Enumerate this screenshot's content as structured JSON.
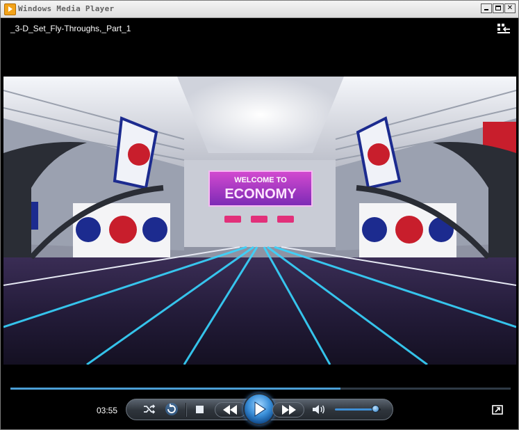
{
  "window": {
    "title": "Windows Media Player",
    "controls": [
      "minimize",
      "maximize",
      "close"
    ]
  },
  "media": {
    "title": "_3-D_Set_Fly-Throughs,_Part_1",
    "video_sign_top": "WELCOME TO",
    "video_sign_main": "ECONOMY"
  },
  "playback": {
    "elapsed": "03:55",
    "progress_fraction": 0.66,
    "volume_fraction": 0.9,
    "state": "paused"
  },
  "icons": {
    "switch_to_library": "switch-to-library-icon",
    "shuffle": "shuffle-icon",
    "repeat": "repeat-icon",
    "stop": "stop-icon",
    "previous": "previous-icon",
    "play": "play-icon",
    "next": "next-icon",
    "mute": "speaker-icon",
    "fullscreen": "fullscreen-icon"
  },
  "colors": {
    "accent": "#3f8fd6",
    "background": "#000000"
  }
}
